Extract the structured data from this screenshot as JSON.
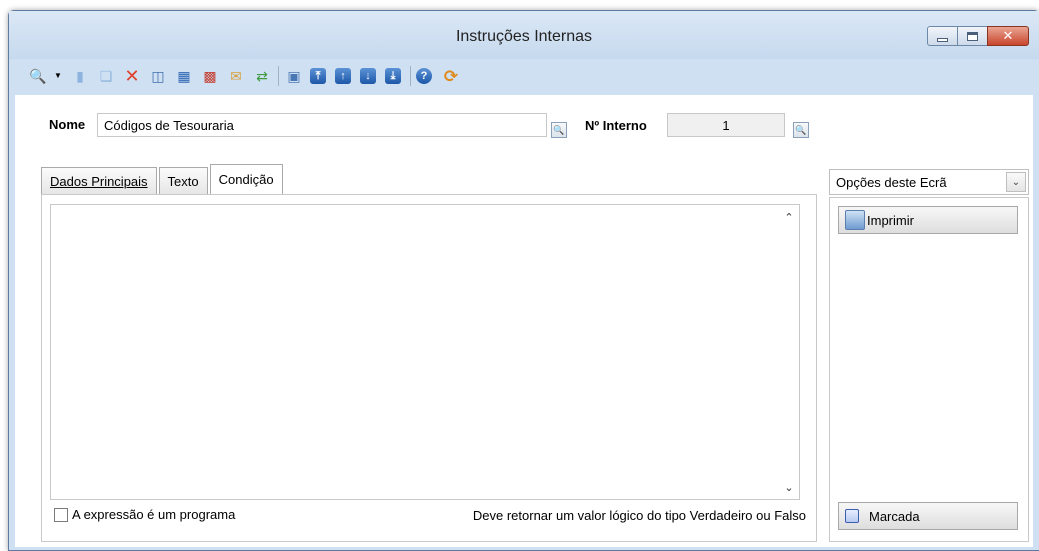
{
  "window": {
    "title": "Instruções Internas",
    "close_glyph": "✕"
  },
  "toolbar": {
    "icons": [
      "search-icon",
      "new-document-icon",
      "copy-icon",
      "delete-icon",
      "properties-icon",
      "table-icon",
      "hierarchy-icon",
      "mail-icon",
      "refresh-icon",
      "preview-icon",
      "first-record-icon",
      "previous-record-icon",
      "next-record-icon",
      "last-record-icon",
      "help-icon",
      "exit-icon"
    ]
  },
  "form": {
    "nome_label": "Nome",
    "nome_value": "Códigos de Tesouraria",
    "interno_label": "Nº Interno",
    "interno_value": "1"
  },
  "tabs": [
    {
      "label": "Dados Principais",
      "active": false
    },
    {
      "label": "Texto",
      "active": false
    },
    {
      "label": "Condição",
      "active": true
    }
  ],
  "panel": {
    "checkbox_label": "A expressão é um programa",
    "checkbox_checked": false,
    "note": "Deve retornar um valor lógico do tipo Verdadeiro ou Falso"
  },
  "options": {
    "dropdown_value": "Opções deste Ecrã",
    "imprimir_label": "Imprimir",
    "marcada_label": "Marcada"
  }
}
